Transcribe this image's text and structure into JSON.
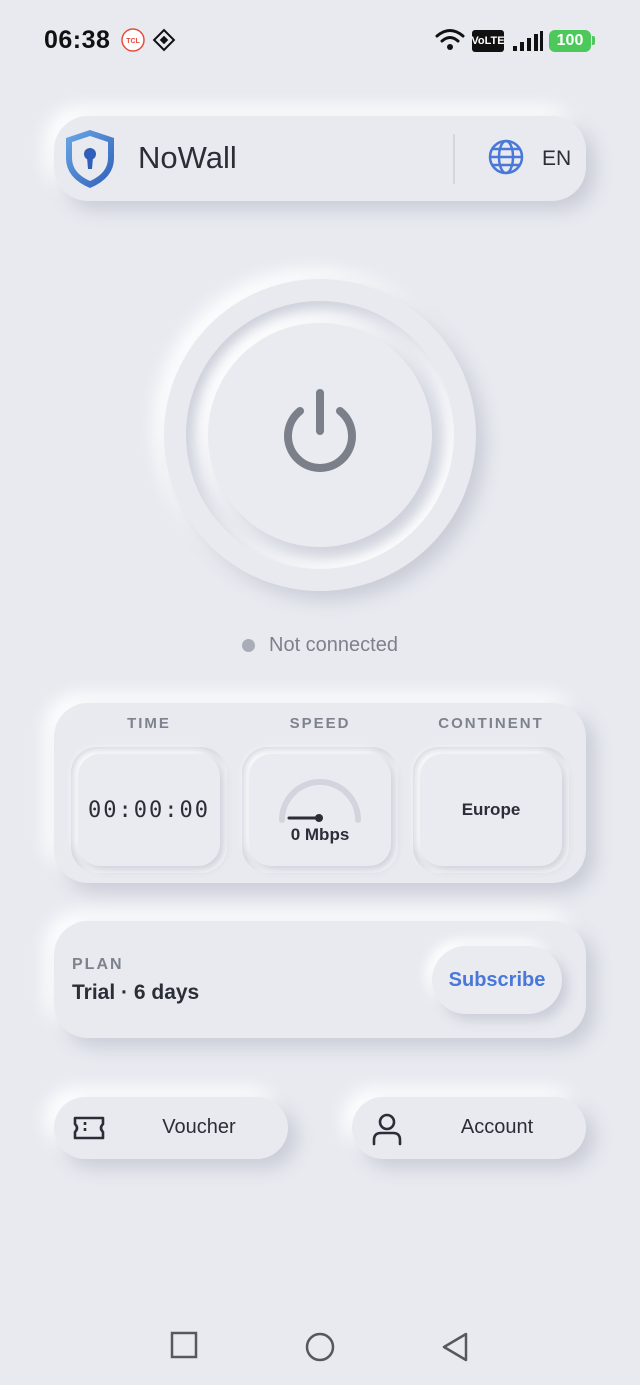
{
  "status_bar": {
    "time": "06:38",
    "network_badge": "VoLTE",
    "battery": "100"
  },
  "header": {
    "app_name": "NoWall",
    "language": "EN",
    "icons": {
      "logo": "shield-keyhole-icon",
      "language": "globe-icon"
    }
  },
  "power": {
    "icon": "power-icon",
    "status_text": "Not connected",
    "status_color": "#a9adb8"
  },
  "stats": {
    "time_label": "TIME",
    "time_value": "00:00:00",
    "speed_label": "SPEED",
    "speed_value": "0 Mbps",
    "continent_label": "CONTINENT",
    "continent_value": "Europe"
  },
  "plan": {
    "label": "PLAN",
    "value": "Trial · 6 days",
    "subscribe_label": "Subscribe",
    "accent_color": "#4a78d8"
  },
  "actions": {
    "voucher_label": "Voucher",
    "account_label": "Account",
    "icons": {
      "voucher": "ticket-icon",
      "account": "user-icon"
    }
  },
  "system_nav": {
    "icons": [
      "recents-square-icon",
      "home-circle-icon",
      "back-triangle-icon"
    ]
  }
}
